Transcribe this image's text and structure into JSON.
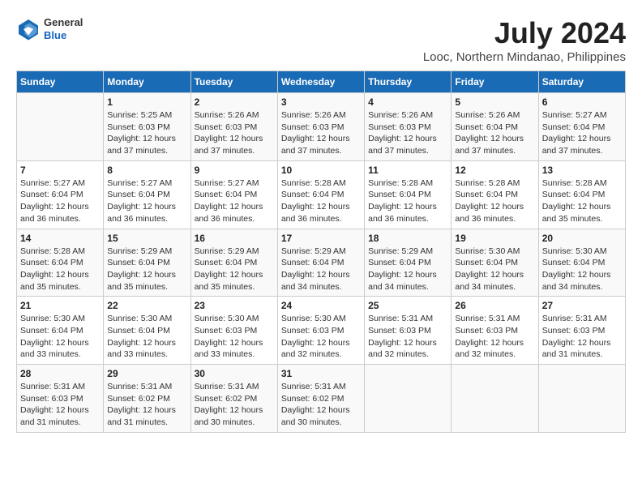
{
  "logo": {
    "general": "General",
    "blue": "Blue"
  },
  "title": "July 2024",
  "subtitle": "Looc, Northern Mindanao, Philippines",
  "headers": [
    "Sunday",
    "Monday",
    "Tuesday",
    "Wednesday",
    "Thursday",
    "Friday",
    "Saturday"
  ],
  "weeks": [
    [
      {
        "day": "",
        "info": ""
      },
      {
        "day": "1",
        "info": "Sunrise: 5:25 AM\nSunset: 6:03 PM\nDaylight: 12 hours\nand 37 minutes."
      },
      {
        "day": "2",
        "info": "Sunrise: 5:26 AM\nSunset: 6:03 PM\nDaylight: 12 hours\nand 37 minutes."
      },
      {
        "day": "3",
        "info": "Sunrise: 5:26 AM\nSunset: 6:03 PM\nDaylight: 12 hours\nand 37 minutes."
      },
      {
        "day": "4",
        "info": "Sunrise: 5:26 AM\nSunset: 6:03 PM\nDaylight: 12 hours\nand 37 minutes."
      },
      {
        "day": "5",
        "info": "Sunrise: 5:26 AM\nSunset: 6:04 PM\nDaylight: 12 hours\nand 37 minutes."
      },
      {
        "day": "6",
        "info": "Sunrise: 5:27 AM\nSunset: 6:04 PM\nDaylight: 12 hours\nand 37 minutes."
      }
    ],
    [
      {
        "day": "7",
        "info": "Sunrise: 5:27 AM\nSunset: 6:04 PM\nDaylight: 12 hours\nand 36 minutes."
      },
      {
        "day": "8",
        "info": "Sunrise: 5:27 AM\nSunset: 6:04 PM\nDaylight: 12 hours\nand 36 minutes."
      },
      {
        "day": "9",
        "info": "Sunrise: 5:27 AM\nSunset: 6:04 PM\nDaylight: 12 hours\nand 36 minutes."
      },
      {
        "day": "10",
        "info": "Sunrise: 5:28 AM\nSunset: 6:04 PM\nDaylight: 12 hours\nand 36 minutes."
      },
      {
        "day": "11",
        "info": "Sunrise: 5:28 AM\nSunset: 6:04 PM\nDaylight: 12 hours\nand 36 minutes."
      },
      {
        "day": "12",
        "info": "Sunrise: 5:28 AM\nSunset: 6:04 PM\nDaylight: 12 hours\nand 36 minutes."
      },
      {
        "day": "13",
        "info": "Sunrise: 5:28 AM\nSunset: 6:04 PM\nDaylight: 12 hours\nand 35 minutes."
      }
    ],
    [
      {
        "day": "14",
        "info": "Sunrise: 5:28 AM\nSunset: 6:04 PM\nDaylight: 12 hours\nand 35 minutes."
      },
      {
        "day": "15",
        "info": "Sunrise: 5:29 AM\nSunset: 6:04 PM\nDaylight: 12 hours\nand 35 minutes."
      },
      {
        "day": "16",
        "info": "Sunrise: 5:29 AM\nSunset: 6:04 PM\nDaylight: 12 hours\nand 35 minutes."
      },
      {
        "day": "17",
        "info": "Sunrise: 5:29 AM\nSunset: 6:04 PM\nDaylight: 12 hours\nand 34 minutes."
      },
      {
        "day": "18",
        "info": "Sunrise: 5:29 AM\nSunset: 6:04 PM\nDaylight: 12 hours\nand 34 minutes."
      },
      {
        "day": "19",
        "info": "Sunrise: 5:30 AM\nSunset: 6:04 PM\nDaylight: 12 hours\nand 34 minutes."
      },
      {
        "day": "20",
        "info": "Sunrise: 5:30 AM\nSunset: 6:04 PM\nDaylight: 12 hours\nand 34 minutes."
      }
    ],
    [
      {
        "day": "21",
        "info": "Sunrise: 5:30 AM\nSunset: 6:04 PM\nDaylight: 12 hours\nand 33 minutes."
      },
      {
        "day": "22",
        "info": "Sunrise: 5:30 AM\nSunset: 6:04 PM\nDaylight: 12 hours\nand 33 minutes."
      },
      {
        "day": "23",
        "info": "Sunrise: 5:30 AM\nSunset: 6:03 PM\nDaylight: 12 hours\nand 33 minutes."
      },
      {
        "day": "24",
        "info": "Sunrise: 5:30 AM\nSunset: 6:03 PM\nDaylight: 12 hours\nand 32 minutes."
      },
      {
        "day": "25",
        "info": "Sunrise: 5:31 AM\nSunset: 6:03 PM\nDaylight: 12 hours\nand 32 minutes."
      },
      {
        "day": "26",
        "info": "Sunrise: 5:31 AM\nSunset: 6:03 PM\nDaylight: 12 hours\nand 32 minutes."
      },
      {
        "day": "27",
        "info": "Sunrise: 5:31 AM\nSunset: 6:03 PM\nDaylight: 12 hours\nand 31 minutes."
      }
    ],
    [
      {
        "day": "28",
        "info": "Sunrise: 5:31 AM\nSunset: 6:03 PM\nDaylight: 12 hours\nand 31 minutes."
      },
      {
        "day": "29",
        "info": "Sunrise: 5:31 AM\nSunset: 6:02 PM\nDaylight: 12 hours\nand 31 minutes."
      },
      {
        "day": "30",
        "info": "Sunrise: 5:31 AM\nSunset: 6:02 PM\nDaylight: 12 hours\nand 30 minutes."
      },
      {
        "day": "31",
        "info": "Sunrise: 5:31 AM\nSunset: 6:02 PM\nDaylight: 12 hours\nand 30 minutes."
      },
      {
        "day": "",
        "info": ""
      },
      {
        "day": "",
        "info": ""
      },
      {
        "day": "",
        "info": ""
      }
    ]
  ]
}
